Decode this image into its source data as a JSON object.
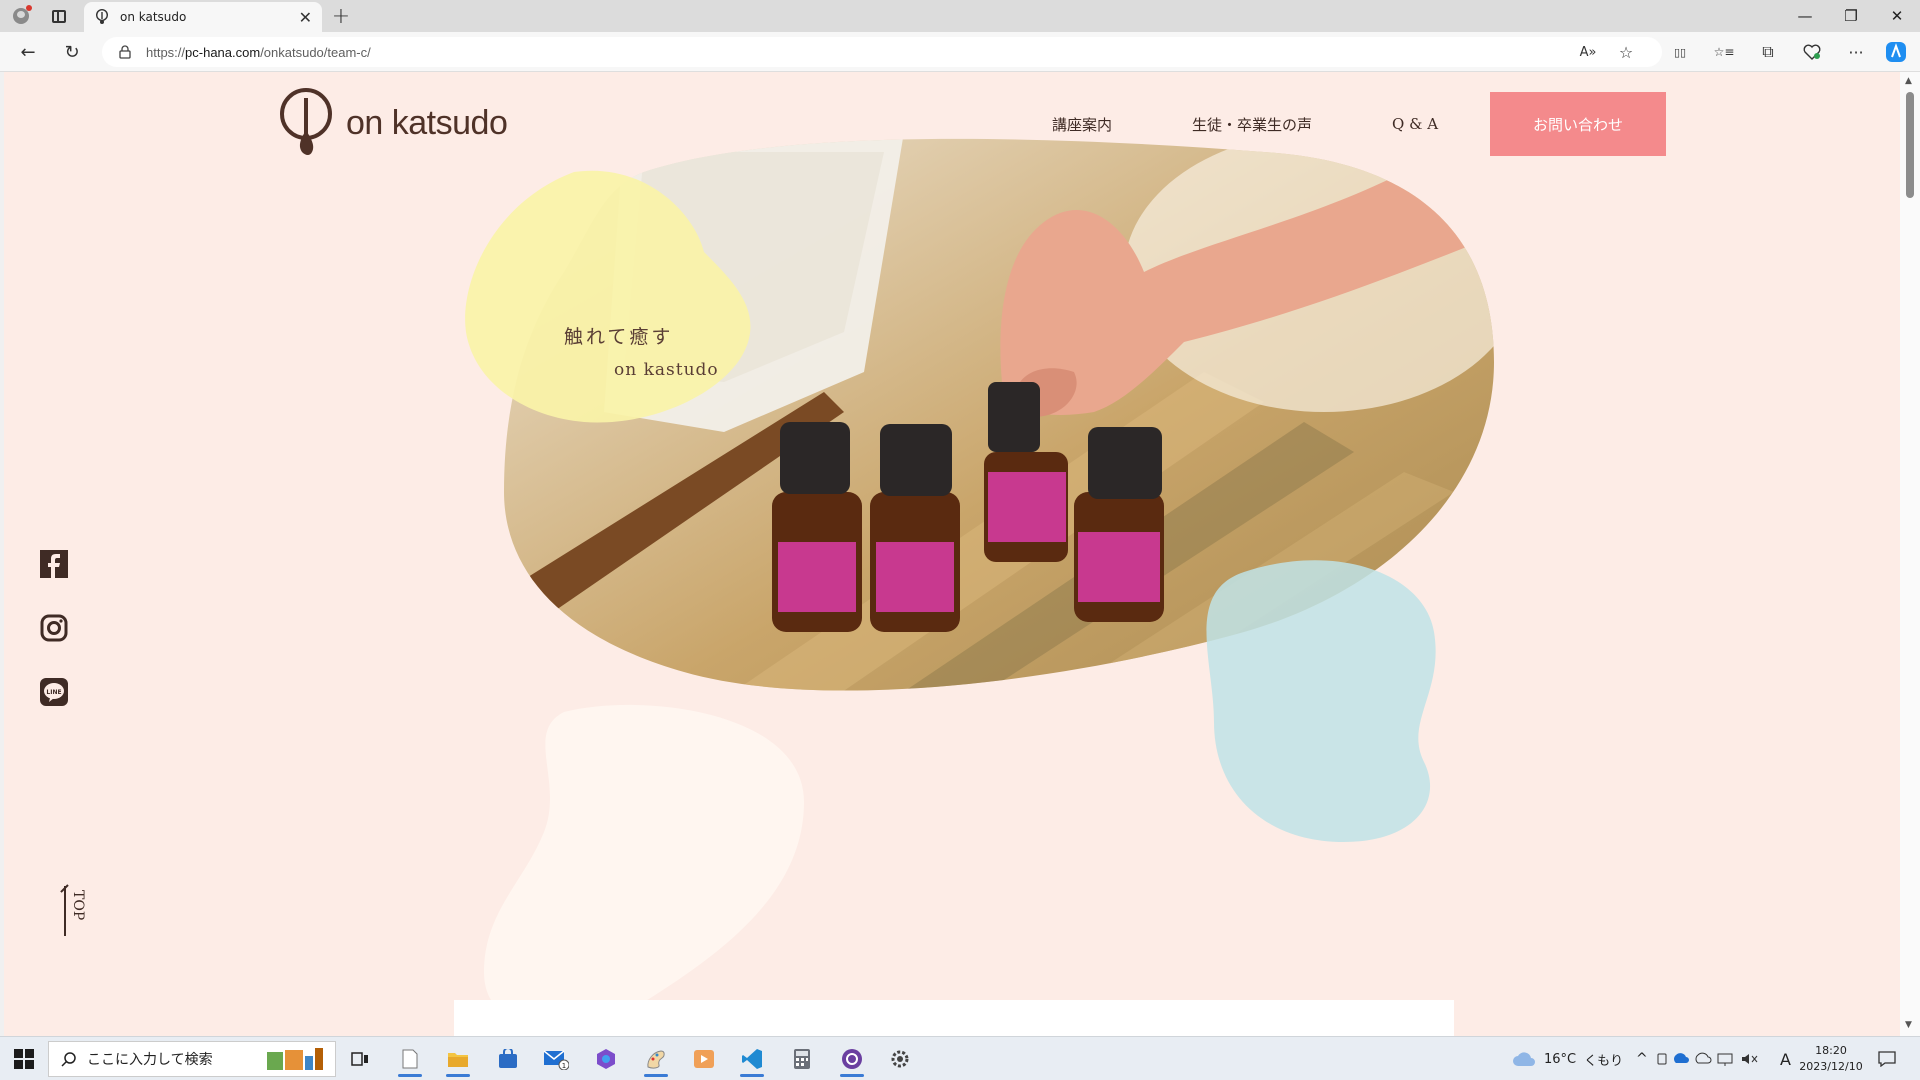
{
  "browser": {
    "tab_title": "on katsudo",
    "url_prefix": "https://",
    "url_domain": "pc-hana.com",
    "url_path": "/onkatsudo/team-c/",
    "close_tab": "✕",
    "new_tab": "+",
    "back": "←",
    "reload": "↻",
    "window_minimize": "—",
    "window_restore": "❐",
    "window_close": "✕",
    "read_aloud": "A»",
    "favorite": "☆",
    "split": "▯▯",
    "favorites_bar": "☆≡",
    "collections": "⧉",
    "more": "···"
  },
  "site": {
    "logo_text": "on katsudo",
    "nav": [
      "講座案内",
      "生徒・卒業生の声",
      "Q & A"
    ],
    "contact_label": "お問い合わせ",
    "hero_line1": "触れて癒す",
    "hero_line2": "on kastudo",
    "top_label": "TOP",
    "social_icons": [
      "facebook-icon",
      "instagram-icon",
      "line-icon"
    ],
    "colors": {
      "background": "#fdece6",
      "accent": "#f48a8c",
      "text": "#3f2b25",
      "yellow_blob": "#faf3a8",
      "blue_blob": "#bfe3e6"
    }
  },
  "taskbar": {
    "search_placeholder": "ここに入力して検索",
    "weather_temp": "16°C",
    "weather_text": "くもり",
    "ime_label": "A",
    "time": "18:20",
    "date": "2023/12/10"
  }
}
